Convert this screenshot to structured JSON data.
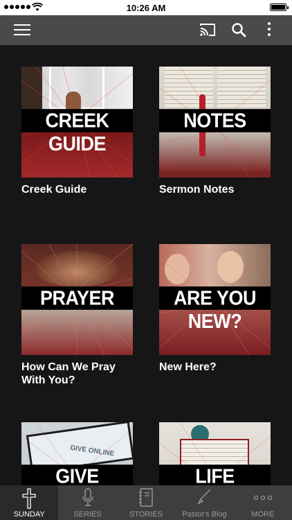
{
  "status": {
    "time": "10:26 AM"
  },
  "appbar": {
    "menu_icon": "hamburger-menu-icon",
    "cast_icon": "cast-icon",
    "search_icon": "search-icon",
    "more_icon": "more-vertical-icon"
  },
  "tiles": [
    {
      "banner": "CREEK GUIDE",
      "caption": "Creek Guide"
    },
    {
      "banner": "NOTES",
      "caption": "Sermon Notes"
    },
    {
      "banner": "PRAYER",
      "caption": "How Can We Pray With You?"
    },
    {
      "banner": "ARE YOU NEW?",
      "caption": "New Here?"
    },
    {
      "banner": "GIVE",
      "caption": "",
      "image_text": "GIVE ONLINE"
    },
    {
      "banner": "LIFE GROUPS",
      "caption": ""
    }
  ],
  "tabbar": {
    "tabs": [
      {
        "label": "SUNDAY",
        "icon": "cross-icon",
        "active": true
      },
      {
        "label": "SERIES",
        "icon": "microphone-icon",
        "active": false
      },
      {
        "label": "STORIES",
        "icon": "notebook-icon",
        "active": false
      },
      {
        "label": "Pastor's Blog",
        "icon": "pencil-icon",
        "active": false
      },
      {
        "label": "MORE",
        "icon": "more-horizontal-icon",
        "active": false
      }
    ]
  },
  "colors": {
    "background": "#161616",
    "appbar": "#4a4a4a",
    "tabbar": "#3e3e3e",
    "accent_red": "#a5292b"
  }
}
